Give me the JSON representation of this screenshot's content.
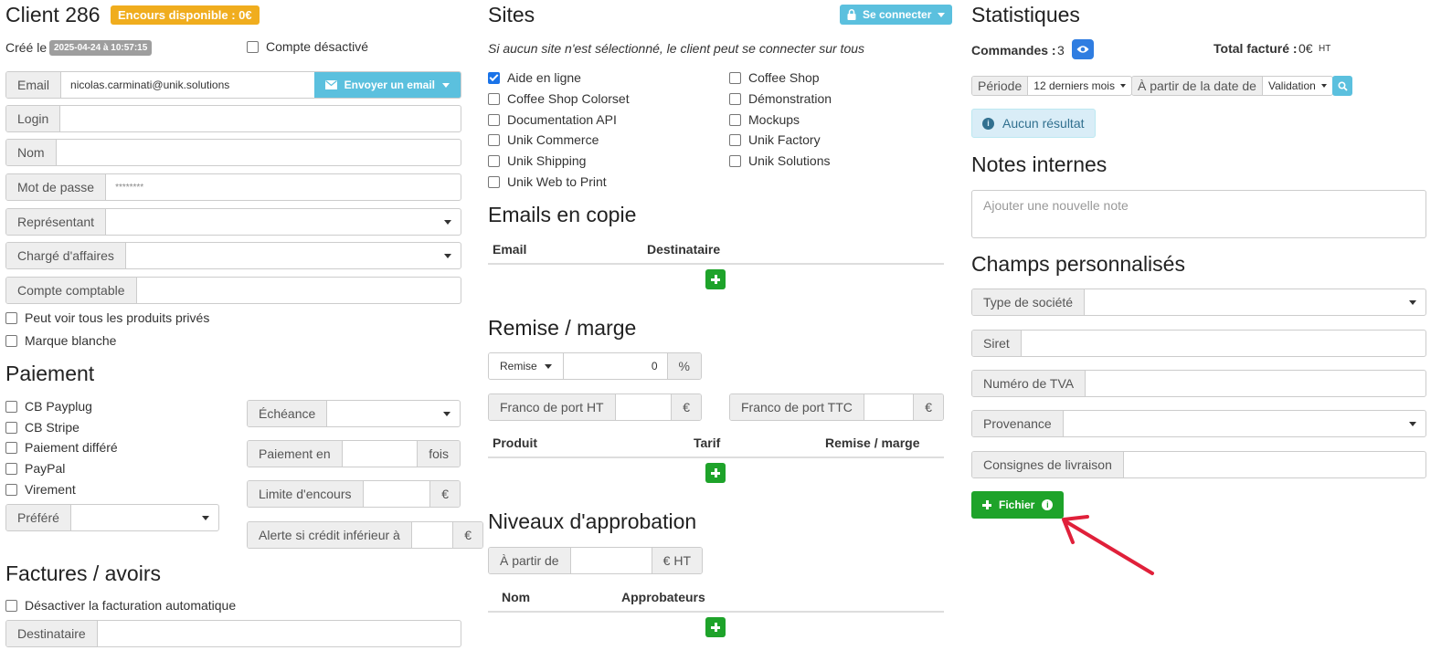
{
  "client": {
    "title": "Client 286",
    "encours_badge": "Encours disponible : 0€",
    "created_label": "Créé le",
    "created_date": "2025-04-24 à 10:57:15",
    "deactivated_label": "Compte désactivé"
  },
  "form": {
    "email_label": "Email",
    "email_value": "nicolas.carminati@unik.solutions",
    "send_email_label": "Envoyer un email",
    "login_label": "Login",
    "login_value": "",
    "nom_label": "Nom",
    "nom_value": "",
    "password_label": "Mot de passe",
    "password_value": "********",
    "representant_label": "Représentant",
    "charge_label": "Chargé d'affaires",
    "compte_comptable_label": "Compte comptable",
    "private_products_label": "Peut voir tous les produits privés",
    "white_label": "Marque blanche"
  },
  "paiement": {
    "heading": "Paiement",
    "methods": [
      {
        "label": "CB Payplug",
        "checked": false
      },
      {
        "label": "CB Stripe",
        "checked": false
      },
      {
        "label": "Paiement différé",
        "checked": false
      },
      {
        "label": "PayPal",
        "checked": false
      },
      {
        "label": "Virement",
        "checked": false
      }
    ],
    "prefere_label": "Préféré",
    "echeance_label": "Échéance",
    "paiement_en_label": "Paiement en",
    "paiement_en_suffix": "fois",
    "limite_label": "Limite d'encours",
    "limite_suffix": "€",
    "alerte_label": "Alerte si crédit inférieur à",
    "alerte_suffix": "€"
  },
  "factures": {
    "heading": "Factures / avoirs",
    "disable_auto_label": "Désactiver la facturation automatique",
    "destinataire_label": "Destinataire"
  },
  "sites": {
    "heading": "Sites",
    "connect_label": "Se connecter",
    "note": "Si aucun site n'est sélectionné, le client peut se connecter sur tous",
    "left": [
      {
        "label": "Aide en ligne",
        "checked": true
      },
      {
        "label": "Coffee Shop Colorset",
        "checked": false
      },
      {
        "label": "Documentation API",
        "checked": false
      },
      {
        "label": "Unik Commerce",
        "checked": false
      },
      {
        "label": "Unik Shipping",
        "checked": false
      },
      {
        "label": "Unik Web to Print",
        "checked": false
      }
    ],
    "right": [
      {
        "label": "Coffee Shop",
        "checked": false
      },
      {
        "label": "Démonstration",
        "checked": false
      },
      {
        "label": "Mockups",
        "checked": false
      },
      {
        "label": "Unik Factory",
        "checked": false
      },
      {
        "label": "Unik Solutions",
        "checked": false
      }
    ]
  },
  "emails_copie": {
    "heading": "Emails en copie",
    "col_email": "Email",
    "col_destinataire": "Destinataire"
  },
  "remise": {
    "heading": "Remise / marge",
    "type_label": "Remise",
    "value": "0",
    "unit": "%",
    "franco_ht_label": "Franco de port HT",
    "franco_ttc_label": "Franco de port TTC",
    "currency": "€",
    "col_produit": "Produit",
    "col_tarif": "Tarif",
    "col_remise": "Remise / marge"
  },
  "approbation": {
    "heading": "Niveaux d'approbation",
    "a_partir_label": "À partir de",
    "a_partir_suffix": "€ HT",
    "col_nom": "Nom",
    "col_approbateurs": "Approbateurs"
  },
  "stats": {
    "heading": "Statistiques",
    "commandes_label": "Commandes :",
    "commandes_value": "3",
    "total_label": "Total facturé :",
    "total_value": "0€",
    "total_unit": "HT",
    "periode_label": "Période",
    "periode_value": "12 derniers mois",
    "date_label": "À partir de la date de",
    "date_value": "Validation",
    "no_result": "Aucun résultat"
  },
  "notes": {
    "heading": "Notes internes",
    "placeholder": "Ajouter une nouvelle note"
  },
  "custom_fields": {
    "heading": "Champs personnalisés",
    "type_societe_label": "Type de société",
    "siret_label": "Siret",
    "tva_label": "Numéro de TVA",
    "provenance_label": "Provenance",
    "consignes_label": "Consignes de livraison",
    "fichier_label": "Fichier"
  },
  "colors": {
    "accent_orange": "#f0ad1e",
    "info": "#5bc0de",
    "success": "#1ea32a",
    "primary": "#2f7de1",
    "annotation_arrow": "#e0203a"
  }
}
